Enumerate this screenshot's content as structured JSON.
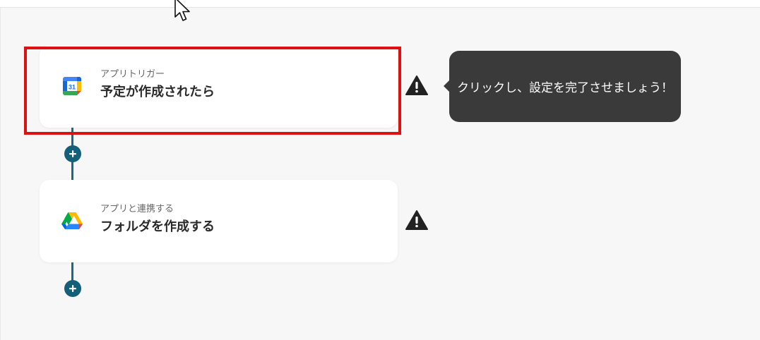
{
  "colors": {
    "background": "#f7f7f7",
    "connector": "#1a6b7f",
    "add_button": "#14607a",
    "highlight_border": "#dd1111",
    "tooltip_bg": "#3a3a3a",
    "warning": "#222222"
  },
  "flow": {
    "steps": [
      {
        "subtitle": "アプリトリガー",
        "title": "予定が作成されたら",
        "icon": "google-calendar-icon",
        "calendar_day": "31",
        "status_icon": "warning-icon",
        "highlighted": true
      },
      {
        "subtitle": "アプリと連携する",
        "title": "フォルダを作成する",
        "icon": "google-drive-icon",
        "status_icon": "warning-icon",
        "highlighted": false
      }
    ],
    "add_step_icon": "plus-icon"
  },
  "tooltip": {
    "text": "クリックし、設定を完了させましょう！"
  },
  "cursor_icon": "mouse-pointer-icon"
}
